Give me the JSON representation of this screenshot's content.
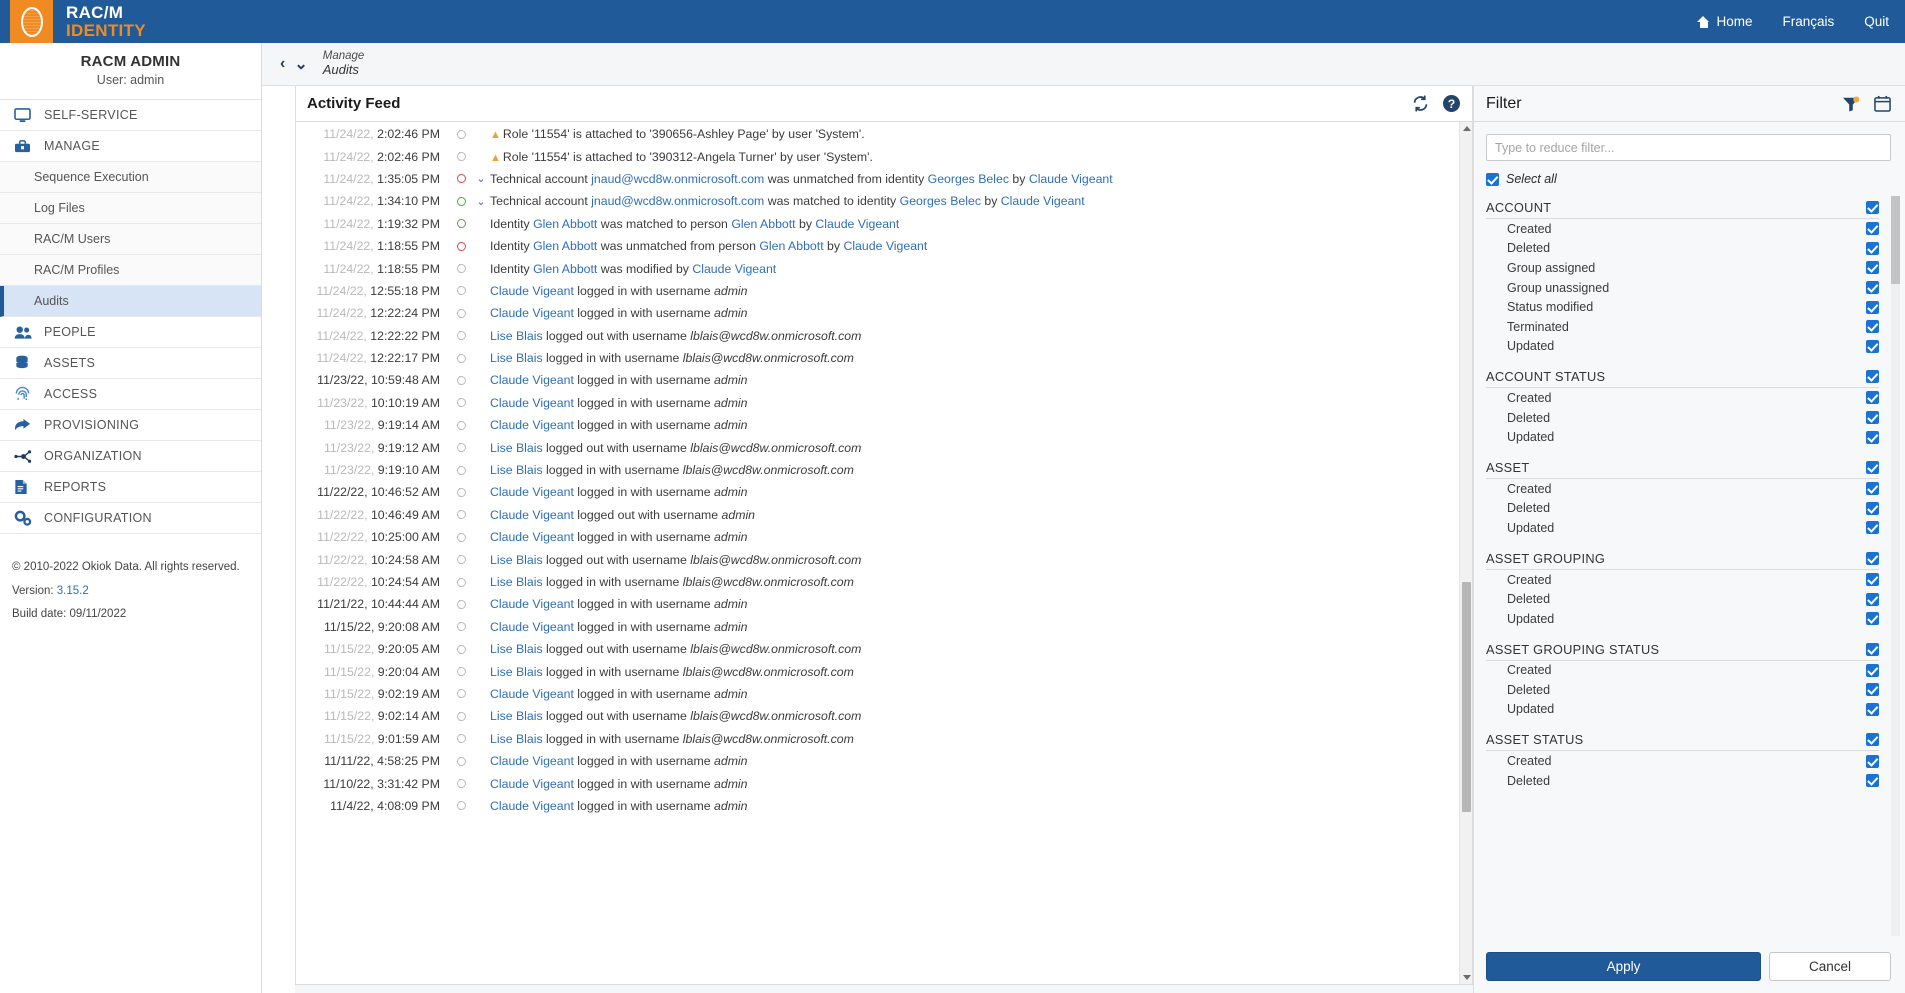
{
  "app": {
    "brand_line1": "RAC/M",
    "brand_line2": "IDENTITY"
  },
  "topnav": {
    "home": "Home",
    "language": "Français",
    "quit": "Quit"
  },
  "sidebar": {
    "user_title": "RACM ADMIN",
    "user_sub": "User: admin",
    "items": [
      {
        "label": "SELF-SERVICE",
        "icon": "monitor-icon",
        "type": "section"
      },
      {
        "label": "MANAGE",
        "icon": "toolbox-icon",
        "type": "section"
      },
      {
        "label": "Sequence Execution",
        "type": "sub"
      },
      {
        "label": "Log Files",
        "type": "sub"
      },
      {
        "label": "RAC/M Users",
        "type": "sub"
      },
      {
        "label": "RAC/M Profiles",
        "type": "sub"
      },
      {
        "label": "Audits",
        "type": "sub",
        "active": true
      },
      {
        "label": "PEOPLE",
        "icon": "people-icon",
        "type": "section"
      },
      {
        "label": "ASSETS",
        "icon": "database-icon",
        "type": "section"
      },
      {
        "label": "ACCESS",
        "icon": "fingerprint-icon",
        "type": "section"
      },
      {
        "label": "PROVISIONING",
        "icon": "arrow-forward-icon",
        "type": "section"
      },
      {
        "label": "ORGANIZATION",
        "icon": "network-icon",
        "type": "section"
      },
      {
        "label": "REPORTS",
        "icon": "document-icon",
        "type": "section"
      },
      {
        "label": "CONFIGURATION",
        "icon": "gears-icon",
        "type": "section"
      }
    ],
    "footer": {
      "copyright": "© 2010-2022 Okiok Data. All rights reserved.",
      "version_label": "Version:",
      "version_value": "3.15.2",
      "build_date": "Build date: 09/11/2022"
    }
  },
  "breadcrumb": {
    "parent": "Manage",
    "current": "Audits"
  },
  "feed": {
    "title": "Activity Feed",
    "refresh_icon": "refresh-icon",
    "help_icon": "help-icon",
    "rows": [
      {
        "date": "11/24/22,",
        "time": "2:02:46 PM",
        "dot": "gray",
        "chevron": false,
        "warn": true,
        "html": "Role '11554' is attached to '390656-Ashley Page' by user 'System'."
      },
      {
        "date": "11/24/22,",
        "time": "2:02:46 PM",
        "dot": "gray",
        "chevron": false,
        "warn": true,
        "html": "Role '11554' is attached to '390312-Angela Turner' by user 'System'."
      },
      {
        "date": "11/24/22,",
        "time": "1:35:05 PM",
        "dot": "red",
        "chevron": true,
        "warn": false,
        "html": "Technical account <a>jnaud@wcd8w.onmicrosoft.com</a> was unmatched from identity <a>Georges Belec</a> by <a>Claude Vigeant</a>"
      },
      {
        "date": "11/24/22,",
        "time": "1:34:10 PM",
        "dot": "green",
        "chevron": true,
        "warn": false,
        "html": "Technical account <a>jnaud@wcd8w.onmicrosoft.com</a> was matched to identity <a>Georges Belec</a> by <a>Claude Vigeant</a>"
      },
      {
        "date": "11/24/22,",
        "time": "1:19:32 PM",
        "dot": "green",
        "chevron": false,
        "warn": false,
        "html": "Identity <a>Glen Abbott</a> was matched to person <a>Glen Abbott</a> by <a>Claude Vigeant</a>"
      },
      {
        "date": "11/24/22,",
        "time": "1:18:55 PM",
        "dot": "red",
        "chevron": false,
        "warn": false,
        "html": "Identity <a>Glen Abbott</a> was unmatched from person <a>Glen Abbott</a> by <a>Claude Vigeant</a>"
      },
      {
        "date": "11/24/22,",
        "time": "1:18:55 PM",
        "dot": "gray",
        "chevron": false,
        "warn": false,
        "html": "Identity <a>Glen Abbott</a> was modified by <a>Claude Vigeant</a>"
      },
      {
        "date": "11/24/22,",
        "time": "12:55:18 PM",
        "dot": "gray",
        "chevron": false,
        "warn": false,
        "html": "<a>Claude Vigeant</a> logged in with username <i>admin</i>"
      },
      {
        "date": "11/24/22,",
        "time": "12:22:24 PM",
        "dot": "gray",
        "chevron": false,
        "warn": false,
        "html": "<a>Claude Vigeant</a> logged in with username <i>admin</i>"
      },
      {
        "date": "11/24/22,",
        "time": "12:22:22 PM",
        "dot": "gray",
        "chevron": false,
        "warn": false,
        "html": "<a>Lise Blais</a> logged out with username <i>lblais@wcd8w.onmicrosoft.com</i>"
      },
      {
        "date": "11/24/22,",
        "time": "12:22:17 PM",
        "dot": "gray",
        "chevron": false,
        "warn": false,
        "html": "<a>Lise Blais</a> logged in with username <i>lblais@wcd8w.onmicrosoft.com</i>"
      },
      {
        "date": "11/23/22,",
        "time": "10:59:48 AM",
        "dot": "gray",
        "chevron": false,
        "warn": false,
        "full": true,
        "html": "<a>Claude Vigeant</a> logged in with username <i>admin</i>"
      },
      {
        "date": "11/23/22,",
        "time": "10:10:19 AM",
        "dot": "gray",
        "chevron": false,
        "warn": false,
        "html": "<a>Claude Vigeant</a> logged in with username <i>admin</i>"
      },
      {
        "date": "11/23/22,",
        "time": "9:19:14 AM",
        "dot": "gray",
        "chevron": false,
        "warn": false,
        "html": "<a>Claude Vigeant</a> logged in with username <i>admin</i>"
      },
      {
        "date": "11/23/22,",
        "time": "9:19:12 AM",
        "dot": "gray",
        "chevron": false,
        "warn": false,
        "html": "<a>Lise Blais</a> logged out with username <i>lblais@wcd8w.onmicrosoft.com</i>"
      },
      {
        "date": "11/23/22,",
        "time": "9:19:10 AM",
        "dot": "gray",
        "chevron": false,
        "warn": false,
        "html": "<a>Lise Blais</a> logged in with username <i>lblais@wcd8w.onmicrosoft.com</i>"
      },
      {
        "date": "11/22/22,",
        "time": "10:46:52 AM",
        "dot": "gray",
        "chevron": false,
        "warn": false,
        "full": true,
        "html": "<a>Claude Vigeant</a> logged in with username <i>admin</i>"
      },
      {
        "date": "11/22/22,",
        "time": "10:46:49 AM",
        "dot": "gray",
        "chevron": false,
        "warn": false,
        "html": "<a>Claude Vigeant</a> logged out with username <i>admin</i>"
      },
      {
        "date": "11/22/22,",
        "time": "10:25:00 AM",
        "dot": "gray",
        "chevron": false,
        "warn": false,
        "html": "<a>Claude Vigeant</a> logged in with username <i>admin</i>"
      },
      {
        "date": "11/22/22,",
        "time": "10:24:58 AM",
        "dot": "gray",
        "chevron": false,
        "warn": false,
        "html": "<a>Lise Blais</a> logged out with username <i>lblais@wcd8w.onmicrosoft.com</i>"
      },
      {
        "date": "11/22/22,",
        "time": "10:24:54 AM",
        "dot": "gray",
        "chevron": false,
        "warn": false,
        "html": "<a>Lise Blais</a> logged in with username <i>lblais@wcd8w.onmicrosoft.com</i>"
      },
      {
        "date": "11/21/22,",
        "time": "10:44:44 AM",
        "dot": "gray",
        "chevron": false,
        "warn": false,
        "full": true,
        "html": "<a>Claude Vigeant</a> logged in with username <i>admin</i>"
      },
      {
        "date": "11/15/22,",
        "time": "9:20:08 AM",
        "dot": "gray",
        "chevron": false,
        "warn": false,
        "full": true,
        "html": "<a>Claude Vigeant</a> logged in with username <i>admin</i>"
      },
      {
        "date": "11/15/22,",
        "time": "9:20:05 AM",
        "dot": "gray",
        "chevron": false,
        "warn": false,
        "html": "<a>Lise Blais</a> logged out with username <i>lblais@wcd8w.onmicrosoft.com</i>"
      },
      {
        "date": "11/15/22,",
        "time": "9:20:04 AM",
        "dot": "gray",
        "chevron": false,
        "warn": false,
        "html": "<a>Lise Blais</a> logged in with username <i>lblais@wcd8w.onmicrosoft.com</i>"
      },
      {
        "date": "11/15/22,",
        "time": "9:02:19 AM",
        "dot": "gray",
        "chevron": false,
        "warn": false,
        "html": "<a>Claude Vigeant</a> logged in with username <i>admin</i>"
      },
      {
        "date": "11/15/22,",
        "time": "9:02:14 AM",
        "dot": "gray",
        "chevron": false,
        "warn": false,
        "html": "<a>Lise Blais</a> logged out with username <i>lblais@wcd8w.onmicrosoft.com</i>"
      },
      {
        "date": "11/15/22,",
        "time": "9:01:59 AM",
        "dot": "gray",
        "chevron": false,
        "warn": false,
        "html": "<a>Lise Blais</a> logged in with username <i>lblais@wcd8w.onmicrosoft.com</i>"
      },
      {
        "date": "11/11/22,",
        "time": "4:58:25 PM",
        "dot": "gray",
        "chevron": false,
        "warn": false,
        "full": true,
        "html": "<a>Claude Vigeant</a> logged in with username <i>admin</i>"
      },
      {
        "date": "11/10/22,",
        "time": "3:31:42 PM",
        "dot": "gray",
        "chevron": false,
        "warn": false,
        "full": true,
        "html": "<a>Claude Vigeant</a> logged in with username <i>admin</i>"
      },
      {
        "date": "11/4/22,",
        "time": "4:08:09 PM",
        "dot": "gray",
        "chevron": false,
        "warn": false,
        "full": true,
        "html": "<a>Claude Vigeant</a> logged in with username <i>admin</i>"
      }
    ]
  },
  "filter": {
    "title": "Filter",
    "filter_icon": "funnel-icon",
    "calendar_icon": "calendar-icon",
    "search_placeholder": "Type to reduce filter...",
    "search_value": "",
    "select_all_label": "Select all",
    "apply_label": "Apply",
    "cancel_label": "Cancel",
    "groups": [
      {
        "name": "ACCOUNT",
        "checked": true,
        "items": [
          {
            "label": "Created",
            "checked": true
          },
          {
            "label": "Deleted",
            "checked": true
          },
          {
            "label": "Group assigned",
            "checked": true
          },
          {
            "label": "Group unassigned",
            "checked": true
          },
          {
            "label": "Status modified",
            "checked": true
          },
          {
            "label": "Terminated",
            "checked": true
          },
          {
            "label": "Updated",
            "checked": true
          }
        ]
      },
      {
        "name": "ACCOUNT STATUS",
        "checked": true,
        "items": [
          {
            "label": "Created",
            "checked": true
          },
          {
            "label": "Deleted",
            "checked": true
          },
          {
            "label": "Updated",
            "checked": true
          }
        ]
      },
      {
        "name": "ASSET",
        "checked": true,
        "items": [
          {
            "label": "Created",
            "checked": true
          },
          {
            "label": "Deleted",
            "checked": true
          },
          {
            "label": "Updated",
            "checked": true
          }
        ]
      },
      {
        "name": "ASSET GROUPING",
        "checked": true,
        "items": [
          {
            "label": "Created",
            "checked": true
          },
          {
            "label": "Deleted",
            "checked": true
          },
          {
            "label": "Updated",
            "checked": true
          }
        ]
      },
      {
        "name": "ASSET GROUPING STATUS",
        "checked": true,
        "items": [
          {
            "label": "Created",
            "checked": true
          },
          {
            "label": "Deleted",
            "checked": true
          },
          {
            "label": "Updated",
            "checked": true
          }
        ]
      },
      {
        "name": "ASSET STATUS",
        "checked": true,
        "items": [
          {
            "label": "Created",
            "checked": true
          },
          {
            "label": "Deleted",
            "checked": true
          }
        ]
      }
    ]
  }
}
